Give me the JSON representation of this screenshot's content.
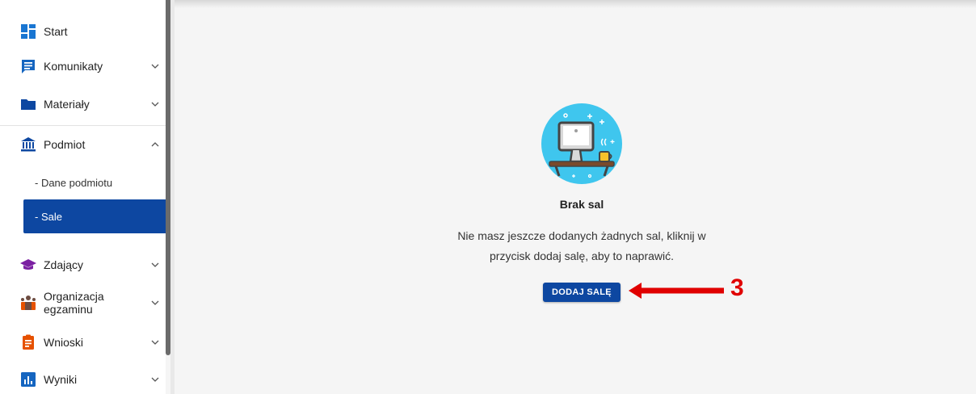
{
  "sidebar": {
    "items": [
      {
        "label": "Start",
        "icon": "dashboard-icon"
      },
      {
        "label": "Komunikaty",
        "icon": "message-icon"
      },
      {
        "label": "Materiały",
        "icon": "folder-icon"
      },
      {
        "label": "Podmiot",
        "icon": "institution-icon"
      },
      {
        "label": "Zdający",
        "icon": "graduation-cap-icon"
      },
      {
        "label": "Organizacja egzaminu",
        "icon": "organization-icon"
      },
      {
        "label": "Wnioski",
        "icon": "clipboard-icon"
      },
      {
        "label": "Wyniki",
        "icon": "chart-icon"
      }
    ],
    "subitems": [
      {
        "label": "- Dane podmiotu"
      },
      {
        "label": "- Sale",
        "active": true
      }
    ]
  },
  "main": {
    "empty_title": "Brak sal",
    "empty_text": "Nie masz jeszcze dodanych żadnych sal, kliknij w przycisk dodaj salę, aby to naprawić.",
    "add_button": "DODAJ SALĘ"
  },
  "annotation": {
    "step": "3"
  },
  "colors": {
    "primary": "#0d47a1",
    "annotation_red": "#e00000",
    "illustration_bg": "#3fc6ee",
    "folder": "#0d47a1",
    "zdajacy": "#7b1fa2",
    "wnioski": "#e65100"
  }
}
